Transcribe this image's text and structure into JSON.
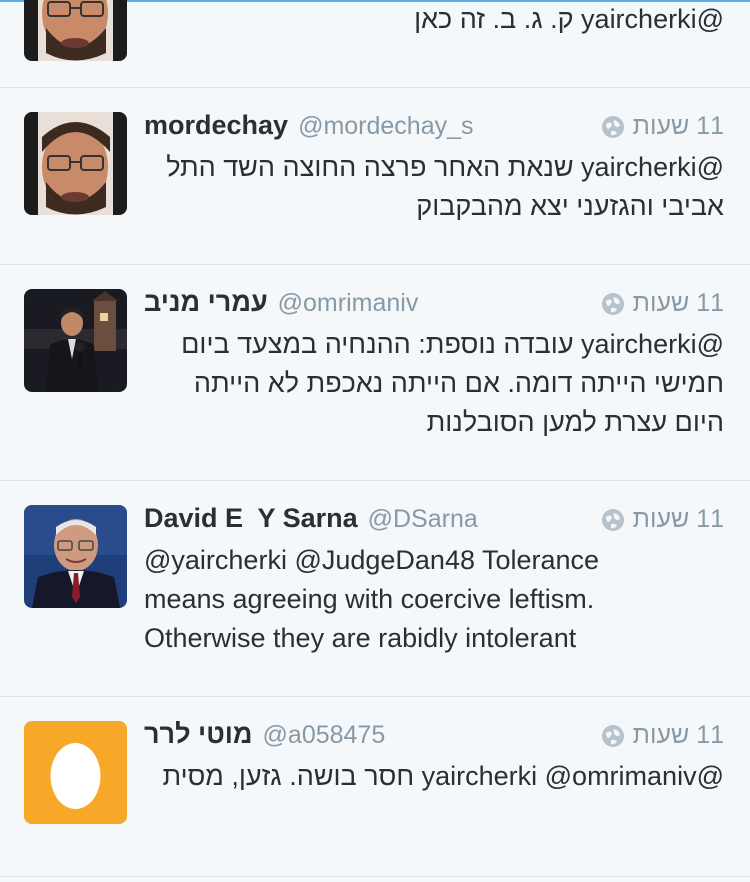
{
  "tweets": [
    {
      "name": "",
      "handle": "",
      "time": "",
      "text": "@yaircherki ק. ג. ב. זה כאן",
      "avatar_icon": "man-glasses-beard-photo",
      "dir": "rtl"
    },
    {
      "name": "mordechay",
      "handle": "@mordechay_s",
      "time": "11 שעות",
      "text": "@yaircherki שנאת האחר פרצה החוצה השד התל אביבי והגזעני יצא מהבקבוק",
      "avatar_icon": "man-glasses-beard-photo",
      "dir": "rtl"
    },
    {
      "name": "עמרי מניב",
      "handle": "@omrimaniv",
      "time": "11 שעות",
      "text": "@yaircherki עובדה נוספת: ההנחיה במצעד ביום חמישי הייתה דומה. אם הייתה נאכפת לא הייתה היום עצרת למען הסובלנות",
      "avatar_icon": "reporter-with-microphone-photo",
      "dir": "rtl"
    },
    {
      "name": "David E  Y Sarna",
      "handle": "@DSarna",
      "time": "11 שעות",
      "text": "@yaircherki @JudgeDan48 Tolerance means agreeing with coercive leftism. Otherwise they are rabidly intolerant",
      "avatar_icon": "older-man-suit-photo",
      "dir": "ltr"
    },
    {
      "name": "מוטי לרר",
      "handle": "@a058475",
      "time": "11 שעות",
      "text": "@yaircherki @omrimaniv חסר בושה. גזען, מסית",
      "avatar_icon": "default-egg-avatar",
      "dir": "rtl"
    }
  ],
  "colors": {
    "accent": "#55acee",
    "muted": "#8899a6",
    "egg": "#f7a828"
  }
}
